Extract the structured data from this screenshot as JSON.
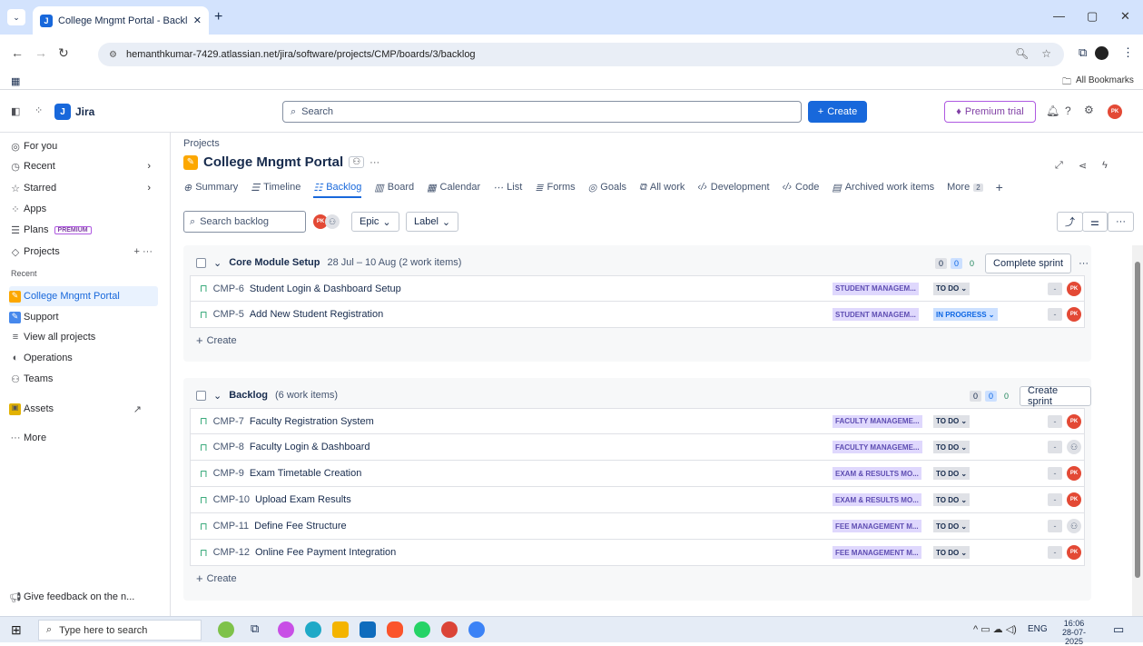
{
  "browser": {
    "tab_title": "College Mngmt Portal - Backlog",
    "url": "hemanthkumar-7429.atlassian.net/jira/software/projects/CMP/boards/3/backlog",
    "bookmarks_label": "All Bookmarks"
  },
  "topbar": {
    "app_name": "Jira",
    "search_placeholder": "Search",
    "create_label": "Create",
    "premium_label": "Premium trial",
    "avatar_initials": "PK"
  },
  "sidebar": {
    "items": [
      {
        "label": "For you",
        "icon": "for-you-icon"
      },
      {
        "label": "Recent",
        "icon": "clock-icon"
      },
      {
        "label": "Starred",
        "icon": "star-icon"
      },
      {
        "label": "Apps",
        "icon": "apps-icon"
      },
      {
        "label": "Plans",
        "icon": "plans-icon",
        "badge": "PREMIUM"
      },
      {
        "label": "Projects",
        "icon": "projects-icon"
      }
    ],
    "recent_heading": "Recent",
    "projects": [
      {
        "label": "College Mngmt Portal",
        "active": true
      },
      {
        "label": "Support"
      }
    ],
    "view_all": "View all projects",
    "more_items": [
      {
        "label": "Operations",
        "icon": "operations-icon"
      },
      {
        "label": "Teams",
        "icon": "teams-icon"
      },
      {
        "label": "Assets",
        "icon": "assets-icon"
      },
      {
        "label": "More",
        "icon": "more-icon"
      }
    ],
    "feedback": "Give feedback on the n..."
  },
  "header": {
    "breadcrumb": "Projects",
    "project_title": "College Mngmt Portal",
    "tabs": [
      "Summary",
      "Timeline",
      "Backlog",
      "Board",
      "Calendar",
      "List",
      "Forms",
      "Goals",
      "All work",
      "Development",
      "Code",
      "Archived work items"
    ],
    "more_label": "More",
    "more_count": "2"
  },
  "filters": {
    "search_placeholder": "Search backlog",
    "epic_label": "Epic",
    "label_label": "Label"
  },
  "sprint": {
    "name": "Core Module Setup",
    "dates": "28 Jul – 10 Aug (2 work items)",
    "counts": [
      "0",
      "0",
      "0"
    ],
    "action": "Complete sprint",
    "items": [
      {
        "key": "CMP-6",
        "summary": "Student Login & Dashboard Setup",
        "epic": "STUDENT MANAGEM...",
        "status": "TO DO",
        "estimate": "-",
        "assignee": "PK"
      },
      {
        "key": "CMP-5",
        "summary": "Add New Student Registration",
        "epic": "STUDENT MANAGEM...",
        "status": "IN PROGRESS",
        "estimate": "-",
        "assignee": "PK"
      }
    ],
    "create_label": "Create"
  },
  "backlog": {
    "name": "Backlog",
    "count_text": "(6 work items)",
    "counts": [
      "0",
      "0",
      "0"
    ],
    "action": "Create sprint",
    "items": [
      {
        "key": "CMP-7",
        "summary": "Faculty Registration System",
        "epic": "FACULTY MANAGEME...",
        "status": "TO DO",
        "estimate": "-",
        "assignee": "PK"
      },
      {
        "key": "CMP-8",
        "summary": "Faculty Login & Dashboard",
        "epic": "FACULTY MANAGEME...",
        "status": "TO DO",
        "estimate": "-",
        "assignee": ""
      },
      {
        "key": "CMP-9",
        "summary": "Exam Timetable Creation",
        "epic": "EXAM & RESULTS MO...",
        "status": "TO DO",
        "estimate": "-",
        "assignee": "PK"
      },
      {
        "key": "CMP-10",
        "summary": "Upload Exam Results",
        "epic": "EXAM & RESULTS MO...",
        "status": "TO DO",
        "estimate": "-",
        "assignee": "PK"
      },
      {
        "key": "CMP-11",
        "summary": "Define Fee Structure",
        "epic": "FEE MANAGEMENT M...",
        "status": "TO DO",
        "estimate": "-",
        "assignee": ""
      },
      {
        "key": "CMP-12",
        "summary": "Online Fee Payment Integration",
        "epic": "FEE MANAGEMENT M...",
        "status": "TO DO",
        "estimate": "-",
        "assignee": "PK"
      }
    ],
    "create_label": "Create"
  },
  "taskbar": {
    "search_placeholder": "Type here to search",
    "lang": "ENG",
    "time": "16:06",
    "date": "28-07-2025"
  }
}
